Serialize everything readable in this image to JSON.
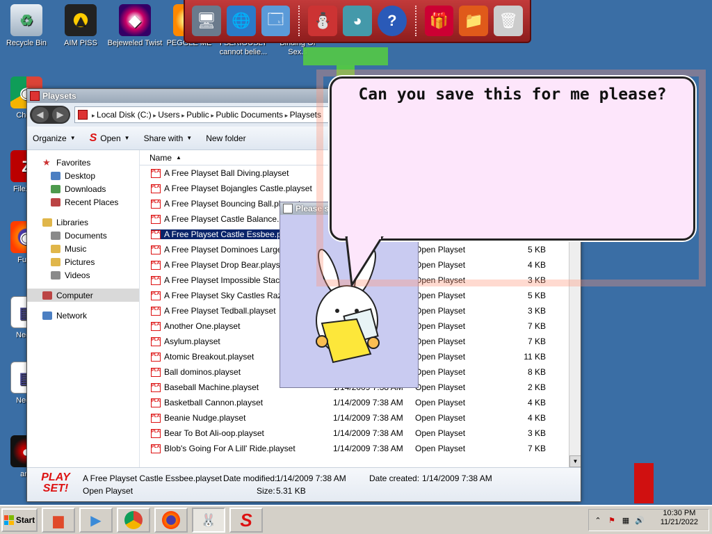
{
  "desktop": {
    "icons": [
      {
        "label": "Recycle Bin",
        "glyph": "♻"
      },
      {
        "label": "AIM PISS",
        "glyph": "▲"
      },
      {
        "label": "Bejeweled Twist",
        "glyph": "◆"
      },
      {
        "label": "PEGGLE ME",
        "glyph": "●"
      },
      {
        "label": "I SERIOUSLY cannot belie...",
        "glyph": ""
      },
      {
        "label": "Binding Of Sex.s",
        "glyph": ""
      },
      {
        "label": "Chom",
        "glyph": "◉"
      },
      {
        "label": "FileZilla",
        "glyph": "Z"
      },
      {
        "label": "Furry",
        "glyph": "◉"
      },
      {
        "label": "Negro",
        "glyph": "▤"
      },
      {
        "label": "Negro",
        "glyph": "▤"
      },
      {
        "label": "anti",
        "glyph": "●"
      }
    ]
  },
  "dock": {
    "items": [
      {
        "name": "computer",
        "glyph": "🖥"
      },
      {
        "name": "network",
        "glyph": "🌐"
      },
      {
        "name": "control-panel",
        "glyph": "🗔"
      },
      {
        "name": "snowman",
        "glyph": "⛄"
      },
      {
        "name": "windows-orb",
        "glyph": "◕"
      },
      {
        "name": "help",
        "glyph": "?"
      },
      {
        "name": "gift",
        "glyph": "🎁"
      },
      {
        "name": "folder",
        "glyph": "📁"
      },
      {
        "name": "recycle-bin",
        "glyph": "🗑"
      }
    ]
  },
  "explorer": {
    "title": "Playsets",
    "address": [
      "Local Disk (C:)",
      "Users",
      "Public",
      "Public Documents",
      "Playsets"
    ],
    "commands": {
      "organize": "Organize",
      "open": "Open",
      "share": "Share with",
      "new_folder": "New folder"
    },
    "nav": {
      "favorites": "Favorites",
      "favorites_items": [
        "Desktop",
        "Downloads",
        "Recent Places"
      ],
      "libraries": "Libraries",
      "libraries_items": [
        "Documents",
        "Music",
        "Pictures",
        "Videos"
      ],
      "computer": "Computer",
      "network": "Network"
    },
    "list": {
      "header_name": "Name",
      "rows": [
        {
          "name": "A Free Playset Ball Diving.playset",
          "date": "",
          "type": "",
          "size": ""
        },
        {
          "name": "A Free Playset Bojangles Castle.playset",
          "date": "",
          "type": "",
          "size": ""
        },
        {
          "name": "A Free Playset Bouncing Ball.playset",
          "date": "",
          "type": "",
          "size": ""
        },
        {
          "name": "A Free Playset Castle Balance.playset",
          "date": "",
          "type": "",
          "size": ""
        },
        {
          "name": "A Free Playset Castle Essbee.playset",
          "date": "",
          "type": "",
          "size": "",
          "selected": true
        },
        {
          "name": "A Free Playset Dominoes Large.playset",
          "date": "",
          "type": "Open Playset",
          "size": "5 KB"
        },
        {
          "name": "A Free Playset Drop Bear.playset",
          "date": "",
          "type": "Open Playset",
          "size": "4 KB"
        },
        {
          "name": "A Free Playset Impossible Stack.playset",
          "date": "",
          "type": "Open Playset",
          "size": "3 KB"
        },
        {
          "name": "A Free Playset Sky Castles Razer.playset",
          "date": "",
          "type": "Open Playset",
          "size": "5 KB"
        },
        {
          "name": "A Free Playset Tedball.playset",
          "date": "",
          "type": "Open Playset",
          "size": "3 KB"
        },
        {
          "name": "Another One.playset",
          "date": "",
          "type": "Open Playset",
          "size": "7 KB"
        },
        {
          "name": "Asylum.playset",
          "date": "",
          "type": "Open Playset",
          "size": "7 KB"
        },
        {
          "name": "Atomic Breakout.playset",
          "date": "",
          "type": "Open Playset",
          "size": "11 KB"
        },
        {
          "name": "Ball dominos.playset",
          "date": "",
          "type": "Open Playset",
          "size": "8 KB"
        },
        {
          "name": "Baseball Machine.playset",
          "date": "1/14/2009 7:38 AM",
          "type": "Open Playset",
          "size": "2 KB"
        },
        {
          "name": "Basketball Cannon.playset",
          "date": "1/14/2009 7:38 AM",
          "type": "Open Playset",
          "size": "4 KB"
        },
        {
          "name": "Beanie Nudge.playset",
          "date": "1/14/2009 7:38 AM",
          "type": "Open Playset",
          "size": "4 KB"
        },
        {
          "name": "Bear To Bot Ali-oop.playset",
          "date": "1/14/2009 7:38 AM",
          "type": "Open Playset",
          "size": "3 KB"
        },
        {
          "name": "Blob's Going For A Lill' Ride.playset",
          "date": "1/14/2009 7:38 AM",
          "type": "Open Playset",
          "size": "7 KB"
        }
      ]
    },
    "details": {
      "logo": "PLAY SET!",
      "filename": "A Free Playset Castle Essbee.playset",
      "date_modified_label": "Date modified:",
      "date_modified": "1/14/2009 7:38 AM",
      "date_created_label": "Date created:",
      "date_created": "1/14/2009 7:38 AM",
      "type": "Open Playset",
      "size_label": "Size:",
      "size": "5.31 KB"
    }
  },
  "popup": {
    "title": "Please s",
    "bubble_text": "Can you save this for me please?"
  },
  "taskbar": {
    "start": "Start",
    "time": "10:30 PM",
    "date": "11/21/2022"
  },
  "colors": {
    "desktop": "#3a6ea5",
    "dock": "#b02c2c",
    "selection": "#0a246a",
    "bubble": "#fde6fb"
  }
}
